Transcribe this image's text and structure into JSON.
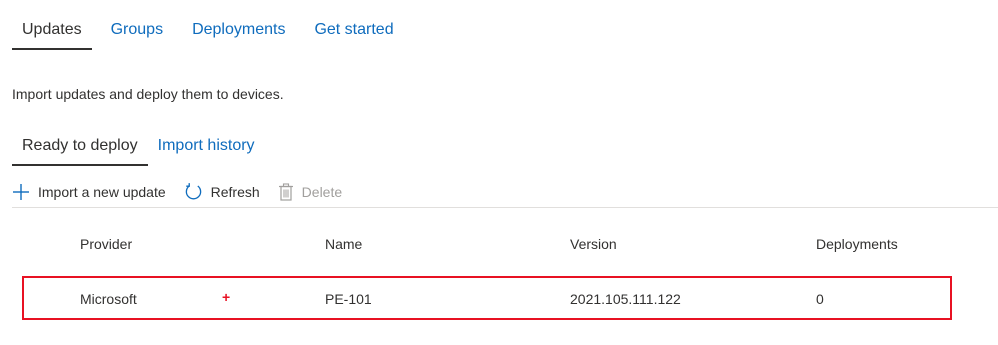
{
  "top_tabs": [
    {
      "label": "Updates"
    },
    {
      "label": "Groups"
    },
    {
      "label": "Deployments"
    },
    {
      "label": "Get started"
    }
  ],
  "description": "Import updates and deploy them to devices.",
  "sub_tabs": [
    {
      "label": "Ready to deploy"
    },
    {
      "label": "Import history"
    }
  ],
  "toolbar": {
    "import_label": "Import a new update",
    "refresh_label": "Refresh",
    "delete_label": "Delete"
  },
  "table": {
    "headers": [
      "Provider",
      "Name",
      "Version",
      "Deployments"
    ],
    "rows": [
      {
        "provider": "Microsoft",
        "marker": "+",
        "name": "PE-101",
        "version": "2021.105.111.122",
        "deployments": "0"
      }
    ]
  },
  "colors": {
    "accent": "#0f6cbd",
    "highlight": "#e81123"
  },
  "icons": [
    "plus-icon",
    "refresh-icon",
    "trash-icon"
  ]
}
